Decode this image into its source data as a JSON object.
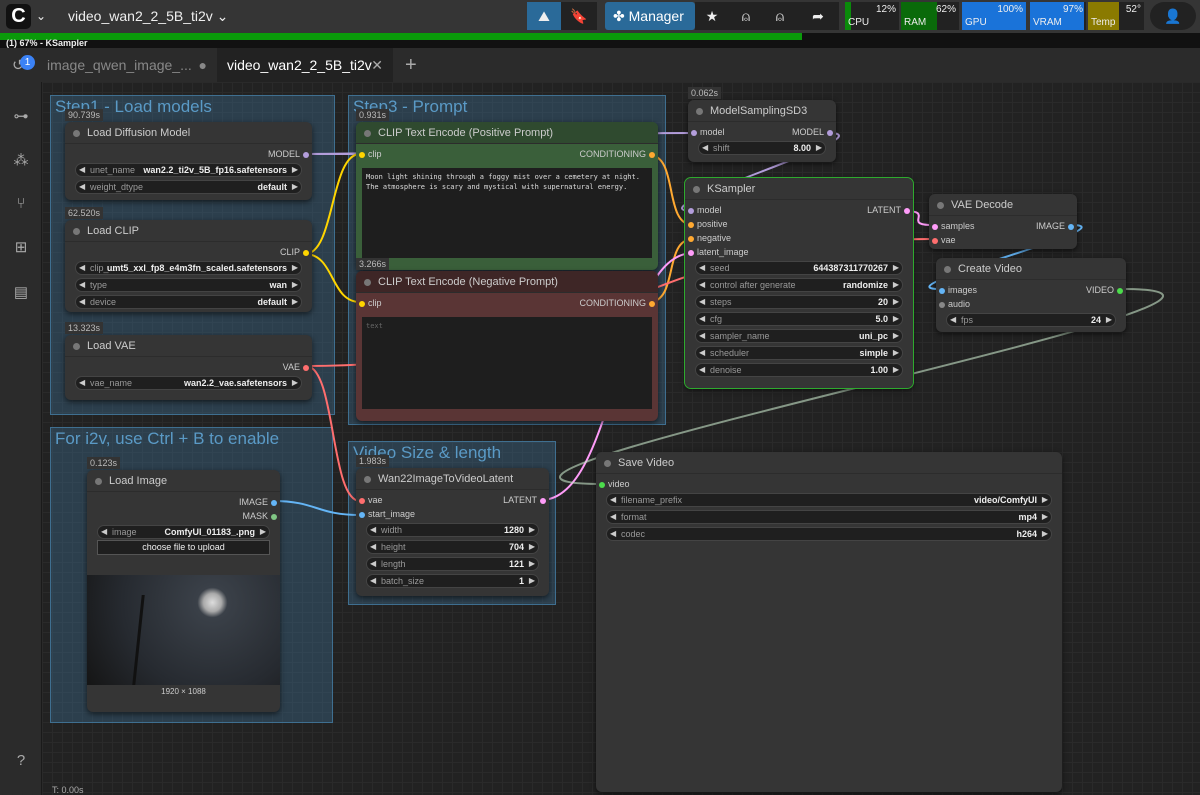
{
  "topbar": {
    "workflow_title": "video_wan2_2_5B_ti2v",
    "manager_label": "Manager",
    "stats": [
      {
        "label": "CPU",
        "value": "12%",
        "fill": 0.12,
        "color": "#0a8a0a"
      },
      {
        "label": "RAM",
        "value": "62%",
        "fill": 0.62,
        "color": "#0a6a0a"
      },
      {
        "label": "GPU",
        "value": "100%",
        "fill": 1.0,
        "color": "#1a73d9"
      },
      {
        "label": "VRAM",
        "value": "97%",
        "fill": 0.97,
        "color": "#1a73d9"
      },
      {
        "label": "Temp",
        "value": "52°",
        "fill": 0.52,
        "color": "#8a7a00"
      }
    ]
  },
  "progress": {
    "text": "(1) 67% - KSampler",
    "percent": 67
  },
  "tabs": [
    {
      "label": "image_qwen_image_...",
      "badge": "1"
    },
    {
      "label": "video_wan2_2_5B_ti2v"
    }
  ],
  "footer": {
    "time": "T: 0.00s"
  },
  "groups": [
    {
      "title": "Step1 - Load models"
    },
    {
      "title": "Step3 - Prompt"
    },
    {
      "title": "For i2v, use Ctrl + B to enable"
    },
    {
      "title": "Video Size & length"
    }
  ],
  "nodes": {
    "load_diffusion": {
      "title": "Load Diffusion Model",
      "time": "90.739s",
      "inputs": [],
      "outputs": [
        {
          "label": "MODEL",
          "color": "#b39ddb"
        }
      ],
      "widgets": [
        {
          "label": "unet_name",
          "value": "wan2.2_ti2v_5B_fp16.safetensors"
        },
        {
          "label": "weight_dtype",
          "value": "default"
        }
      ]
    },
    "load_clip": {
      "title": "Load CLIP",
      "time": "62.520s",
      "inputs": [],
      "outputs": [
        {
          "label": "CLIP",
          "color": "#ffd500"
        }
      ],
      "widgets": [
        {
          "label": "clip_...",
          "value": "umt5_xxl_fp8_e4m3fn_scaled.safetensors"
        },
        {
          "label": "type",
          "value": "wan"
        },
        {
          "label": "device",
          "value": "default"
        }
      ]
    },
    "load_vae": {
      "title": "Load VAE",
      "time": "13.323s",
      "inputs": [],
      "outputs": [
        {
          "label": "VAE",
          "color": "#ff6e6e"
        }
      ],
      "widgets": [
        {
          "label": "vae_name",
          "value": "wan2.2_vae.safetensors"
        }
      ]
    },
    "clip_pos": {
      "title": "CLIP Text Encode (Positive Prompt)",
      "time": "0.931s",
      "inputs": [
        {
          "label": "clip",
          "color": "#ffd500"
        }
      ],
      "outputs": [
        {
          "label": "CONDITIONING",
          "color": "#ffa931"
        }
      ],
      "widgets": [],
      "text": "Moon light shining through a foggy mist over a cemetery at night. The atmosphere is scary and mystical with supernatural energy."
    },
    "clip_neg": {
      "title": "CLIP Text Encode (Negative Prompt)",
      "time": "3.266s",
      "inputs": [
        {
          "label": "clip",
          "color": "#ffd500"
        }
      ],
      "outputs": [
        {
          "label": "CONDITIONING",
          "color": "#ffa931"
        }
      ],
      "widgets": [],
      "placeholder": "text"
    },
    "model_sampling": {
      "title": "ModelSamplingSD3",
      "time": "0.062s",
      "inputs": [
        {
          "label": "model",
          "color": "#b39ddb"
        }
      ],
      "outputs": [
        {
          "label": "MODEL",
          "color": "#b39ddb"
        }
      ],
      "widgets": [
        {
          "label": "shift",
          "value": "8.00"
        }
      ]
    },
    "ksampler": {
      "title": "KSampler",
      "inputs": [
        {
          "label": "model",
          "color": "#b39ddb"
        },
        {
          "label": "positive",
          "color": "#ffa931"
        },
        {
          "label": "negative",
          "color": "#ffa931"
        },
        {
          "label": "latent_image",
          "color": "#ff9cf9"
        }
      ],
      "outputs": [
        {
          "label": "LATENT",
          "color": "#ff9cf9"
        }
      ],
      "widgets": [
        {
          "label": "seed",
          "value": "644387311770267"
        },
        {
          "label": "control after generate",
          "value": "randomize"
        },
        {
          "label": "steps",
          "value": "20"
        },
        {
          "label": "cfg",
          "value": "5.0"
        },
        {
          "label": "sampler_name",
          "value": "uni_pc"
        },
        {
          "label": "scheduler",
          "value": "simple"
        },
        {
          "label": "denoise",
          "value": "1.00"
        }
      ]
    },
    "vae_decode": {
      "title": "VAE Decode",
      "inputs": [
        {
          "label": "samples",
          "color": "#ff9cf9"
        },
        {
          "label": "vae",
          "color": "#ff6e6e"
        }
      ],
      "outputs": [
        {
          "label": "IMAGE",
          "color": "#64b5f6"
        }
      ],
      "widgets": []
    },
    "create_video": {
      "title": "Create Video",
      "inputs": [
        {
          "label": "images",
          "color": "#64b5f6"
        },
        {
          "label": "audio",
          "color": "#888888"
        }
      ],
      "outputs": [
        {
          "label": "VIDEO",
          "color": "#4cdc4c"
        }
      ],
      "widgets": [
        {
          "label": "fps",
          "value": "24"
        }
      ]
    },
    "load_image": {
      "title": "Load Image",
      "time": "0.123s",
      "inputs": [],
      "outputs": [
        {
          "label": "IMAGE",
          "color": "#64b5f6"
        },
        {
          "label": "MASK",
          "color": "#81c784"
        }
      ],
      "widgets": [
        {
          "label": "image",
          "value": "ComfyUI_01183_.png"
        }
      ],
      "upload_label": "choose file to upload",
      "image_size": "1920 × 1088"
    },
    "wan22": {
      "title": "Wan22ImageToVideoLatent",
      "time": "1.983s",
      "inputs": [
        {
          "label": "vae",
          "color": "#ff6e6e"
        },
        {
          "label": "start_image",
          "color": "#64b5f6"
        }
      ],
      "outputs": [
        {
          "label": "LATENT",
          "color": "#ff9cf9"
        }
      ],
      "widgets": [
        {
          "label": "width",
          "value": "1280"
        },
        {
          "label": "height",
          "value": "704"
        },
        {
          "label": "length",
          "value": "121"
        },
        {
          "label": "batch_size",
          "value": "1"
        }
      ]
    },
    "save_video": {
      "title": "Save Video",
      "inputs": [
        {
          "label": "video",
          "color": "#4cdc4c"
        }
      ],
      "outputs": [],
      "widgets": [
        {
          "label": "filename_prefix",
          "value": "video/ComfyUI"
        },
        {
          "label": "format",
          "value": "mp4"
        },
        {
          "label": "codec",
          "value": "h264"
        }
      ]
    }
  }
}
